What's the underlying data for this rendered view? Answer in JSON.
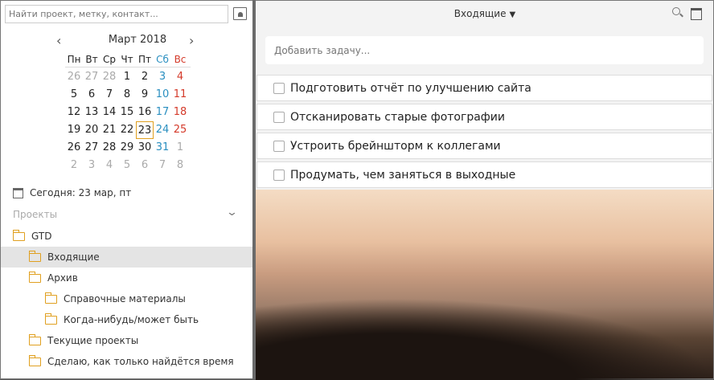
{
  "sidebar": {
    "search_placeholder": "Найти проект, метку, контакт...",
    "calendar": {
      "month": "Март 2018",
      "weekdays": [
        "Пн",
        "Вт",
        "Ср",
        "Чт",
        "Пт",
        "Сб",
        "Вс"
      ],
      "weeks": [
        [
          "26",
          "27",
          "28",
          "1",
          "2",
          "3",
          "4"
        ],
        [
          "5",
          "6",
          "7",
          "8",
          "9",
          "10",
          "11"
        ],
        [
          "12",
          "13",
          "14",
          "15",
          "16",
          "17",
          "18"
        ],
        [
          "19",
          "20",
          "21",
          "22",
          "23",
          "24",
          "25"
        ],
        [
          "26",
          "27",
          "28",
          "29",
          "30",
          "31",
          "1"
        ],
        [
          "2",
          "3",
          "4",
          "5",
          "6",
          "7",
          "8"
        ]
      ],
      "selected": "23"
    },
    "today": "Сегодня: 23 мар, пт",
    "projects_header": "Проекты",
    "projects": [
      {
        "label": "GTD",
        "level": 0
      },
      {
        "label": "Входящие",
        "level": 1,
        "selected": true
      },
      {
        "label": "Архив",
        "level": 1
      },
      {
        "label": "Справочные материалы",
        "level": 2
      },
      {
        "label": "Когда-нибудь/может быть",
        "level": 2
      },
      {
        "label": "Текущие проекты",
        "level": 1
      },
      {
        "label": "Сделаю, как только найдётся время",
        "level": 1
      }
    ]
  },
  "main": {
    "title": "Входящие",
    "add_placeholder": "Добавить задачу...",
    "tasks": [
      "Подготовить отчёт по улучшению сайта",
      "Отсканировать старые фотографии",
      "Устроить брейншторм к коллегами",
      "Продумать, чем заняться в выходные"
    ]
  },
  "colors": {
    "accent": "#e0a020",
    "saturday": "#2a8fc0",
    "sunday": "#d43a2a"
  }
}
